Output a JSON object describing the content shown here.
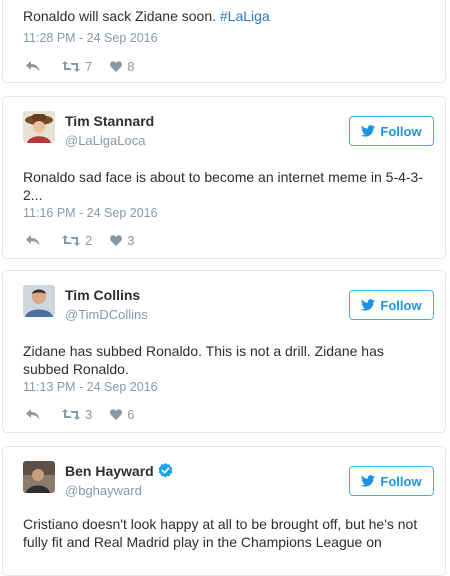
{
  "colors": {
    "accent": "#1b95e0",
    "muted": "#8899a6",
    "text": "#292f33",
    "border": "#e1e8ed",
    "verified": "#1da1f2"
  },
  "follow_label": "Follow",
  "tweets": [
    {
      "text_pre": "Ronaldo will sack Zidane soon. ",
      "hashtag": "#LaLiga",
      "time": "11:28 PM - 24 Sep 2016",
      "retweets": "7",
      "likes": "8"
    },
    {
      "name": "Tim Stannard",
      "handle": "@LaLigaLoca",
      "text": "Ronaldo sad face is about to become an internet meme in 5-4-3-2...",
      "time": "11:16 PM - 24 Sep 2016",
      "retweets": "2",
      "likes": "3"
    },
    {
      "name": "Tim Collins",
      "handle": "@TimDCollins",
      "text": "Zidane has subbed Ronaldo. This is not a drill. Zidane has subbed Ronaldo.",
      "time": "11:13 PM - 24 Sep 2016",
      "retweets": "3",
      "likes": "6"
    },
    {
      "name": "Ben Hayward",
      "handle": "@bghayward",
      "verified": true,
      "text": "Cristiano doesn't look happy at all to be brought off, but he's not fully fit and Real Madrid play in the Champions League on"
    }
  ]
}
